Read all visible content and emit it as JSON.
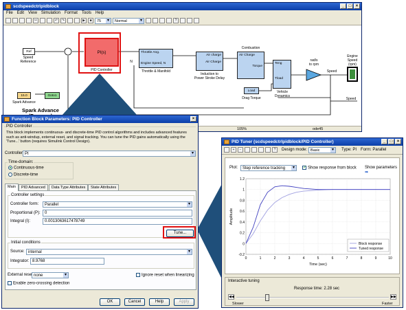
{
  "simulink": {
    "title": "scdspeedctrlpidblock",
    "menu": [
      "File",
      "Edit",
      "View",
      "Simulation",
      "Format",
      "Tools",
      "Help"
    ],
    "toolbar": {
      "stop_time": "75",
      "mode": "Normal"
    },
    "blocks": {
      "speed_ref_label": "Ref",
      "speed_ref_caption": "Speed\nReference",
      "pid_label": "PI(s)",
      "pid_caption": "PID Controller",
      "throttle_in1": "Throttle Ang.",
      "throttle_in2": "Engine Speed, N",
      "throttle_caption": "Throttle & Manifold",
      "induction_in": "Air charge",
      "induction_out": "Air Charge",
      "induction_caption": "Induction to\nPower Stroke Delay",
      "combustion_title": "Combustion",
      "combustion_in1": "Air Charge",
      "combustion_out": "Torque",
      "vehicle_in1": "Teng",
      "vehicle_in2": "Tload",
      "vehicle_caption": "Vehicle\nDynamics",
      "gain_caption": "rad/s\nto rpm",
      "speed_label": "Speed",
      "engine_speed_caption": "Engine\nSpeed\n(rpm)",
      "load_label": "Load",
      "drag_caption": "Drag Torque",
      "spark_value": "15.0",
      "spark_caption": "Spark Advance",
      "goto_label": "Goto1",
      "spark_title": "Spark Advance\n(Degrees)",
      "speed_out": "Speed",
      "n_label": "N",
      "status_zoom": "105%",
      "status_solver": "ode45"
    }
  },
  "dialog": {
    "title": "Function Block Parameters: PID Controller",
    "section": "PID Controller",
    "description": "This block implements continuous- and discrete-time PID control algorithms and includes advanced features such as anti-windup, external reset, and signal tracking. You can tune the PID gains automatically using the 'Tune...' button (requires Simulink Control Design).",
    "controller_label": "Controller:",
    "controller_value": "PI",
    "time_domain_label": "Time-domain:",
    "continuous": "Continuous-time",
    "discrete": "Discrete-time",
    "tabs": [
      "Main",
      "PID Advanced",
      "Data Type Attributes",
      "State Attributes"
    ],
    "settings_group": "Controller settings",
    "form_label": "Controller form:",
    "form_value": "Parallel",
    "p_label": "Proportional (P):",
    "p_value": "0",
    "i_label": "Integral (I):",
    "i_value": "0.0013063617478749",
    "tune_button": "Tune...",
    "initial_group": "Initial conditions",
    "source_label": "Source:",
    "source_value": "internal",
    "integrator_label": "Integrator:",
    "integrator_value": "8.9768",
    "external_reset_label": "External reset:",
    "external_reset_value": "none",
    "ignore_reset": "Ignore reset when linearizing",
    "zero_crossing": "Enable zero-crossing detection",
    "ok": "OK",
    "cancel": "Cancel",
    "help": "Help",
    "apply": "Apply"
  },
  "tuner": {
    "title": "PID Tuner (scdspeedctrlpidblock/PID Controller)",
    "design_mode_label": "Design mode:",
    "design_mode_value": "Basic",
    "type_label": "Type: PI",
    "form_label": "Form: Parallel",
    "plot_label": "Plot:",
    "plot_value": "Step reference tracking",
    "show_block_response": "Show response from block",
    "show_parameters": "Show parameters",
    "interactive_tuning": "Interactive tuning",
    "response_time": "Response time: 2.28 sec",
    "slower": "Slower",
    "faster": "Faster"
  },
  "chart_data": {
    "type": "line",
    "xlabel": "Time (sec)",
    "ylabel": "Amplitude",
    "xlim": [
      0,
      10
    ],
    "ylim": [
      -0.2,
      1.2
    ],
    "xticks": [
      0,
      1,
      2,
      3,
      4,
      5,
      6,
      7,
      8,
      9,
      10
    ],
    "yticks": [
      -0.2,
      0,
      0.2,
      0.4,
      0.6,
      0.8,
      1,
      1.2
    ],
    "grid": true,
    "legend_position": "bottom-right",
    "series": [
      {
        "name": "Block response",
        "color": "#a0a0e0",
        "x": [
          0,
          0.5,
          1,
          1.5,
          2,
          2.5,
          3,
          3.5,
          4,
          5,
          6,
          7,
          8,
          9,
          10
        ],
        "y": [
          0,
          0.18,
          0.42,
          0.62,
          0.76,
          0.85,
          0.91,
          0.95,
          0.97,
          0.99,
          1.0,
          1.0,
          1.0,
          1.0,
          1.0
        ]
      },
      {
        "name": "Tuned response",
        "color": "#4040c0",
        "x": [
          0,
          0.5,
          1,
          1.5,
          2,
          2.5,
          3,
          3.5,
          4,
          5,
          6,
          7,
          8,
          9,
          10
        ],
        "y": [
          0,
          0.3,
          0.72,
          0.95,
          1.05,
          1.07,
          1.06,
          1.04,
          1.02,
          1.0,
          1.0,
          1.0,
          1.0,
          1.0,
          1.0
        ]
      }
    ]
  }
}
